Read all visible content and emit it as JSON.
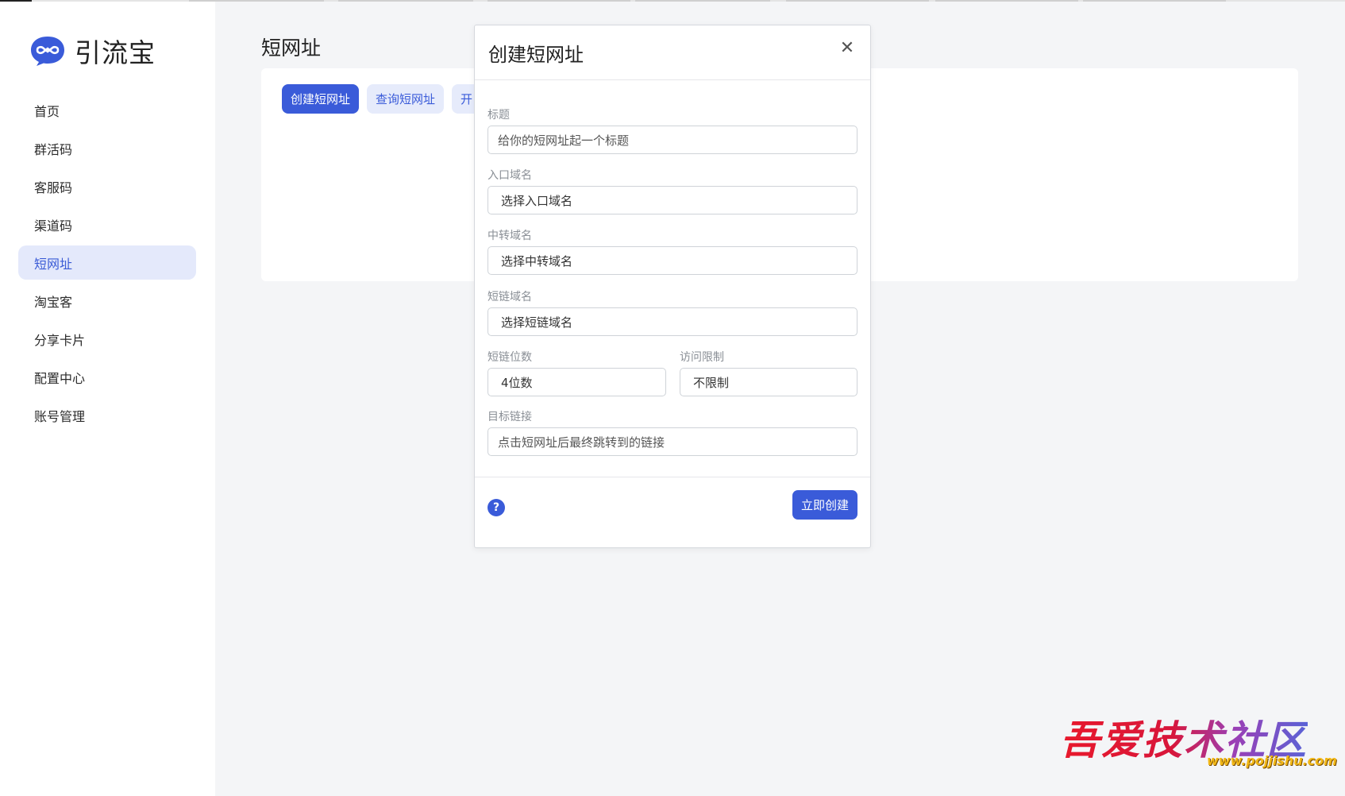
{
  "app": {
    "name": "引流宝",
    "logo_icon": "infinity-bubble-logo"
  },
  "sidebar": {
    "items": [
      {
        "label": "首页",
        "active": false
      },
      {
        "label": "群活码",
        "active": false
      },
      {
        "label": "客服码",
        "active": false
      },
      {
        "label": "渠道码",
        "active": false
      },
      {
        "label": "短网址",
        "active": true
      },
      {
        "label": "淘宝客",
        "active": false
      },
      {
        "label": "分享卡片",
        "active": false
      },
      {
        "label": "配置中心",
        "active": false
      },
      {
        "label": "账号管理",
        "active": false
      }
    ]
  },
  "main": {
    "title": "短网址",
    "buttons": {
      "create": "创建短网址",
      "query": "查询短网址",
      "third_partial": "开"
    }
  },
  "modal": {
    "title": "创建短网址",
    "close_icon": "close-icon",
    "fields": {
      "title": {
        "label": "标题",
        "placeholder": "给你的短网址起一个标题"
      },
      "entry_domain": {
        "label": "入口域名",
        "value": "选择入口域名"
      },
      "relay_domain": {
        "label": "中转域名",
        "value": "选择中转域名"
      },
      "short_domain": {
        "label": "短链域名",
        "value": "选择短链域名"
      },
      "short_digits": {
        "label": "短链位数",
        "value": "4位数"
      },
      "access_limit": {
        "label": "访问限制",
        "value": "不限制"
      },
      "target_link": {
        "label": "目标链接",
        "placeholder": "点击短网址后最终跳转到的链接"
      }
    },
    "help_icon": "?",
    "submit": "立即创建"
  },
  "watermark": {
    "text": "吾爱技术社区",
    "url": "www.pojjishu.com"
  },
  "colors": {
    "accent": "#3a5bd9",
    "accent_light": "#e6ebfb",
    "background": "#f4f5f7"
  }
}
